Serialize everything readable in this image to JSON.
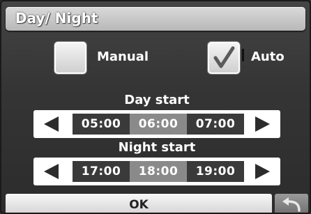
{
  "window": {
    "title": "Day/ Night"
  },
  "mode": {
    "manual": {
      "label": "Manual",
      "checked": false
    },
    "auto": {
      "label": "Auto",
      "checked": true
    }
  },
  "day_start": {
    "title": "Day start",
    "options": [
      "05:00",
      "06:00",
      "07:00"
    ],
    "selected": "06:00"
  },
  "night_start": {
    "title": "Night start",
    "options": [
      "17:00",
      "18:00",
      "19:00"
    ],
    "selected": "18:00"
  },
  "footer": {
    "ok_label": "OK"
  },
  "icons": {
    "prev": "left-arrow-icon",
    "next": "right-arrow-icon",
    "check": "checkmark-icon",
    "back": "back-arrow-icon"
  }
}
